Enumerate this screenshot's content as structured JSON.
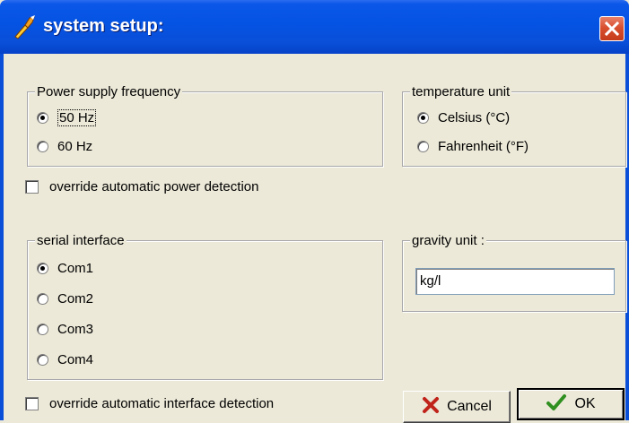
{
  "window": {
    "title": "system setup:"
  },
  "power_frequency": {
    "label": "Power supply frequency",
    "options": [
      {
        "label": "50 Hz",
        "selected": true
      },
      {
        "label": "60 Hz",
        "selected": false
      }
    ]
  },
  "override_power": {
    "label": "override automatic power detection",
    "checked": false
  },
  "temperature_unit": {
    "label": "temperature unit",
    "options": [
      {
        "label": "Celsius (°C)",
        "selected": true
      },
      {
        "label": "Fahrenheit (°F)",
        "selected": false
      }
    ]
  },
  "serial_interface": {
    "label": "serial interface",
    "options": [
      {
        "label": "Com1",
        "selected": true
      },
      {
        "label": "Com2",
        "selected": false
      },
      {
        "label": "Com3",
        "selected": false
      },
      {
        "label": "Com4",
        "selected": false
      }
    ]
  },
  "gravity_unit": {
    "label": "gravity unit :",
    "value": "kg/l"
  },
  "override_interface": {
    "label": "override automatic interface detection",
    "checked": false
  },
  "buttons": {
    "cancel": "Cancel",
    "ok": "OK"
  },
  "colors": {
    "titlebar": "#0553e3",
    "dialog_bg": "#ece9d8",
    "close_button": "#d9502f",
    "ok_check": "#2f8f1f",
    "cancel_x": "#c0231a"
  },
  "icons": {
    "title": "setup-wrench-icon",
    "close": "close-icon",
    "cancel": "x-cross-icon",
    "ok": "checkmark-icon"
  }
}
